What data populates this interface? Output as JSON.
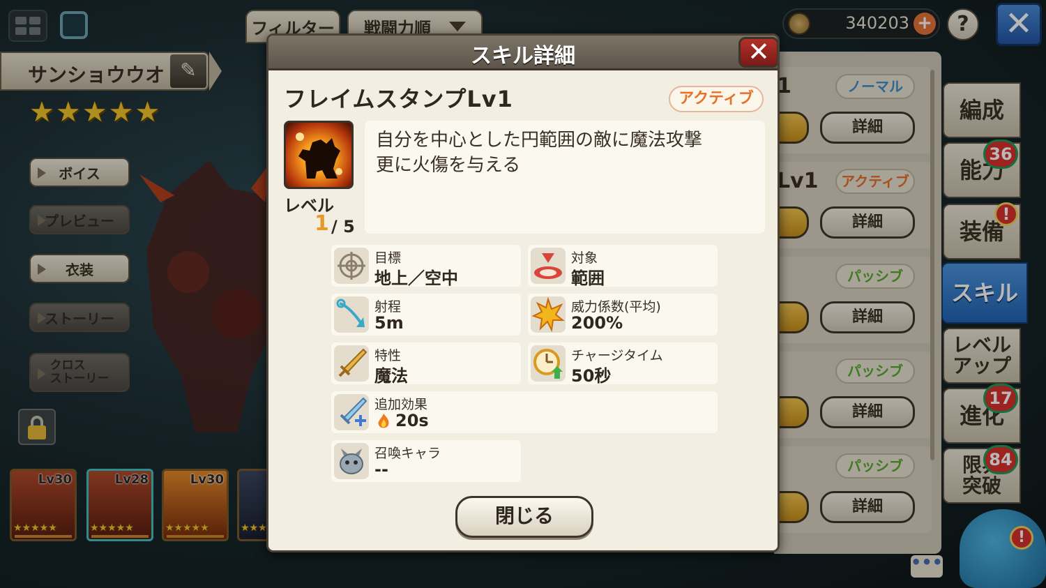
{
  "top_bar": {
    "filter_label": "フィルター",
    "sort_label": "戦闘力順",
    "currency_value": "340203",
    "help_label": "?",
    "close_label": "✕"
  },
  "character": {
    "name": "サンショウウオ",
    "stars": "★★★★★"
  },
  "side_menu": {
    "items": [
      {
        "label": "ボイス"
      },
      {
        "label": "プレビュー"
      },
      {
        "label": "衣装"
      },
      {
        "label": "ストーリー"
      },
      {
        "label": "クロス\nストーリー"
      }
    ]
  },
  "roster": [
    {
      "level": "Lv30",
      "stars": "★★★★★"
    },
    {
      "level": "Lv28",
      "stars": "★★★★★"
    },
    {
      "level": "Lv30",
      "stars": "★★★★★"
    },
    {
      "level": "",
      "stars": "★★★"
    }
  ],
  "skill_list": {
    "rows": [
      {
        "title": "1",
        "type": "ノーマル",
        "detail": "詳細"
      },
      {
        "title": "Lv1",
        "type": "アクティブ",
        "detail": "詳細"
      },
      {
        "title": "",
        "type": "パッシブ",
        "detail": "詳細"
      },
      {
        "title": "",
        "type": "パッシブ",
        "detail": "詳細"
      },
      {
        "title": "",
        "type": "パッシブ",
        "detail": "詳細"
      }
    ]
  },
  "tabs": [
    {
      "label": "編成",
      "badge": ""
    },
    {
      "label": "能力",
      "badge": "36"
    },
    {
      "label": "装備",
      "badge": "!"
    },
    {
      "label": "スキル",
      "badge": ""
    },
    {
      "label": "レベル\nアップ",
      "badge": ""
    },
    {
      "label": "進化",
      "badge": "17"
    },
    {
      "label": "限界\n突破",
      "badge": "84"
    }
  ],
  "chat_label": "•••",
  "mascot_alert": "!",
  "modal": {
    "title": "スキル詳細",
    "close_icon": "✕",
    "skill_name": "フレイムスタンプLv1",
    "skill_type": "アクティブ",
    "level_label": "レベル",
    "level_current": "1",
    "level_max": "/ 5",
    "description": "自分を中心とした円範囲の敵に魔法攻撃\n更に火傷を与える",
    "stats": [
      {
        "icon": "crosshair-icon",
        "label": "目標",
        "value": "地上／空中"
      },
      {
        "icon": "area-target-icon",
        "label": "対象",
        "value": "範囲"
      },
      {
        "icon": "range-arrow-icon",
        "label": "射程",
        "value": "5m"
      },
      {
        "icon": "burst-icon",
        "label": "威力係数(平均)",
        "value": "200%"
      },
      {
        "icon": "sword-icon",
        "label": "特性",
        "value": "魔法"
      },
      {
        "icon": "clock-icon",
        "label": "チャージタイム",
        "value": "50秒"
      },
      {
        "icon": "sword-plus-icon",
        "label": "追加効果",
        "value": "20s"
      },
      {
        "icon": "summon-icon",
        "label": "召喚キャラ",
        "value": "--"
      }
    ],
    "close_button": "閉じる"
  },
  "colors": {
    "accent_orange": "#e8702a",
    "active_tab_blue": "#2264b4",
    "level_gold": "#e59a2c"
  }
}
